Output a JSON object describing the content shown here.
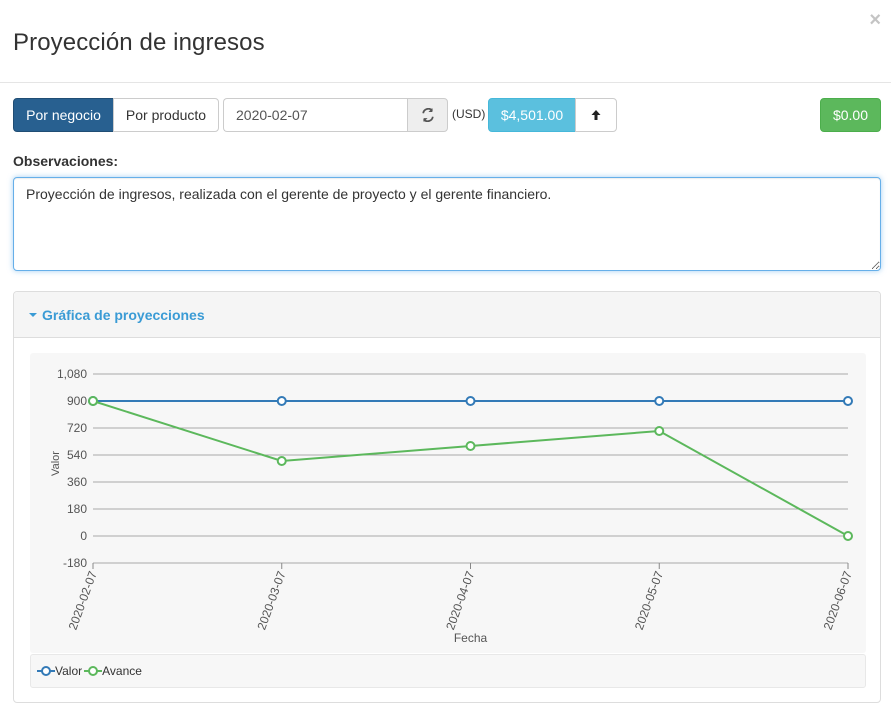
{
  "modal": {
    "title": "Proyección de ingresos",
    "close_label": "×"
  },
  "toolbar": {
    "by_business_label": "Por negocio",
    "by_product_label": "Por producto",
    "date_value": "2020-02-07",
    "currency_label": "(USD)",
    "amount_label": "$4,501.00",
    "total_label": "$0.00"
  },
  "observations": {
    "label": "Observaciones:",
    "text": "Proyección de ingresos, realizada con el gerente de proyecto y el gerente financiero."
  },
  "panel": {
    "heading": "Gráfica de proyecciones"
  },
  "colors": {
    "valor": "#337ab7",
    "avance": "#5cb85c",
    "primary": "#286090",
    "info": "#5bc0de",
    "success": "#5cb85c"
  },
  "chart_data": {
    "type": "line",
    "x": [
      "2020-02-07",
      "2020-03-07",
      "2020-04-07",
      "2020-05-07",
      "2020-06-07"
    ],
    "series": [
      {
        "name": "Valor",
        "values": [
          900,
          900,
          900,
          900,
          900
        ]
      },
      {
        "name": "Avance",
        "values": [
          900,
          500,
          600,
          700,
          0
        ]
      }
    ],
    "xlabel": "Fecha",
    "ylabel": "Valor",
    "ylim": [
      -180,
      1080
    ],
    "yticks": [
      "1,080",
      "900",
      "720",
      "540",
      "360",
      "180",
      "0",
      "-180"
    ],
    "grid": true,
    "legend_position": "bottom-left"
  }
}
